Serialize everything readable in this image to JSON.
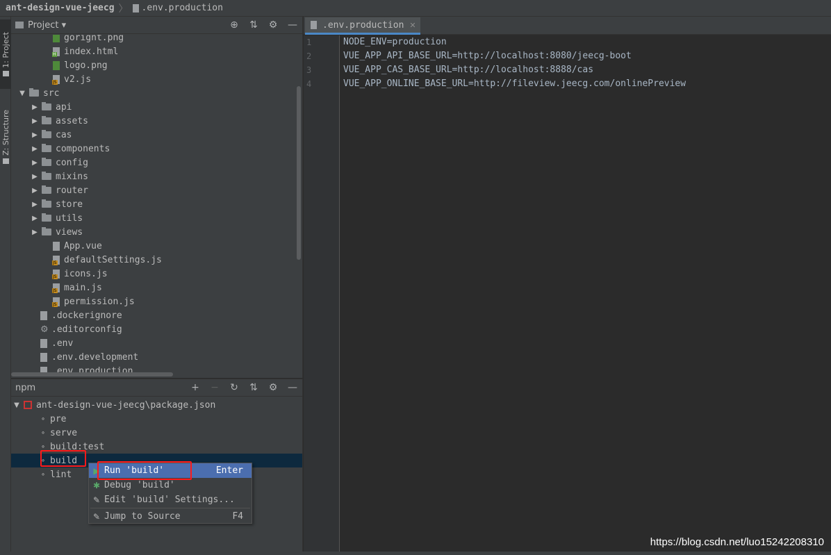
{
  "navbar": {
    "project": "ant-design-vue-jeecg",
    "separator": "〉",
    "file": ".env.production"
  },
  "toolstrip": {
    "project_tab": "1: Project",
    "structure_tab": "Z: Structure"
  },
  "project_panel": {
    "title": "Project ▾",
    "tree": [
      {
        "label": "gorignt.png",
        "kind": "img"
      },
      {
        "label": "index.html",
        "kind": "html"
      },
      {
        "label": "logo.png",
        "kind": "img"
      },
      {
        "label": "v2.js",
        "kind": "js"
      },
      {
        "label": "src",
        "kind": "folder-open"
      },
      {
        "label": "api",
        "kind": "folder"
      },
      {
        "label": "assets",
        "kind": "folder"
      },
      {
        "label": "cas",
        "kind": "folder"
      },
      {
        "label": "components",
        "kind": "folder"
      },
      {
        "label": "config",
        "kind": "folder"
      },
      {
        "label": "mixins",
        "kind": "folder"
      },
      {
        "label": "router",
        "kind": "folder"
      },
      {
        "label": "store",
        "kind": "folder"
      },
      {
        "label": "utils",
        "kind": "folder"
      },
      {
        "label": "views",
        "kind": "folder"
      },
      {
        "label": "App.vue",
        "kind": "vue"
      },
      {
        "label": "defaultSettings.js",
        "kind": "js"
      },
      {
        "label": "icons.js",
        "kind": "js"
      },
      {
        "label": "main.js",
        "kind": "js"
      },
      {
        "label": "permission.js",
        "kind": "js"
      },
      {
        "label": ".dockerignore",
        "kind": "doc"
      },
      {
        "label": ".editorconfig",
        "kind": "gear"
      },
      {
        "label": ".env",
        "kind": "doc"
      },
      {
        "label": ".env.development",
        "kind": "doc"
      },
      {
        "label": ".env.production",
        "kind": "doc"
      }
    ]
  },
  "npm_panel": {
    "title": "npm",
    "package": "ant-design-vue-jeecg\\package.json",
    "scripts": [
      "pre",
      "serve",
      "build:test",
      "build",
      "lint"
    ],
    "selected": "build"
  },
  "context_menu": {
    "items": [
      {
        "label": "Run 'build'",
        "shortcut": "Enter",
        "icon": "run-icon"
      },
      {
        "label": "Debug 'build'",
        "shortcut": "",
        "icon": "debug-icon"
      },
      {
        "label": "Edit 'build' Settings...",
        "shortcut": "",
        "icon": "edit-icon"
      },
      {
        "label": "Jump to Source",
        "shortcut": "F4",
        "icon": "jump-icon"
      }
    ]
  },
  "editor": {
    "tab": ".env.production",
    "lines": [
      "NODE_ENV=production",
      "VUE_APP_API_BASE_URL=http://localhost:8080/jeecg-boot",
      "VUE_APP_CAS_BASE_URL=http://localhost:8888/cas",
      "VUE_APP_ONLINE_BASE_URL=http://fileview.jeecg.com/onlinePreview"
    ],
    "line_numbers": [
      "1",
      "2",
      "3",
      "4"
    ]
  },
  "watermark": "https://blog.csdn.net/luo15242208310",
  "colors": {
    "accent": "#4b6eaf",
    "highlight": "#ff1a1a",
    "selection": "#0d293e"
  }
}
